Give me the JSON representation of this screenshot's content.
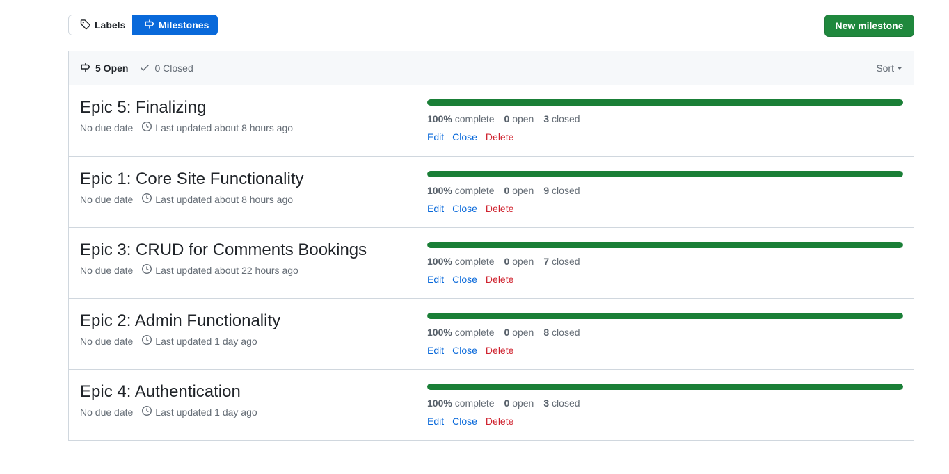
{
  "subnav": {
    "labels_label": "Labels",
    "milestones_label": "Milestones"
  },
  "new_milestone_label": "New milestone",
  "header": {
    "open_count": "5 Open",
    "closed_count": "0 Closed",
    "sort_label": "Sort"
  },
  "milestones": [
    {
      "title": "Epic 5: Finalizing",
      "due": "No due date",
      "updated": "Last updated about 8 hours ago",
      "percent": "100%",
      "percent_value": 100,
      "complete_label": "complete",
      "open": "0",
      "open_label": "open",
      "closed": "3",
      "closed_label": "closed",
      "edit": "Edit",
      "close": "Close",
      "delete": "Delete"
    },
    {
      "title": "Epic 1: Core Site Functionality",
      "due": "No due date",
      "updated": "Last updated about 8 hours ago",
      "percent": "100%",
      "percent_value": 100,
      "complete_label": "complete",
      "open": "0",
      "open_label": "open",
      "closed": "9",
      "closed_label": "closed",
      "edit": "Edit",
      "close": "Close",
      "delete": "Delete"
    },
    {
      "title": "Epic 3: CRUD for Comments Bookings",
      "due": "No due date",
      "updated": "Last updated about 22 hours ago",
      "percent": "100%",
      "percent_value": 100,
      "complete_label": "complete",
      "open": "0",
      "open_label": "open",
      "closed": "7",
      "closed_label": "closed",
      "edit": "Edit",
      "close": "Close",
      "delete": "Delete"
    },
    {
      "title": "Epic 2: Admin Functionality",
      "due": "No due date",
      "updated": "Last updated 1 day ago",
      "percent": "100%",
      "percent_value": 100,
      "complete_label": "complete",
      "open": "0",
      "open_label": "open",
      "closed": "8",
      "closed_label": "closed",
      "edit": "Edit",
      "close": "Close",
      "delete": "Delete"
    },
    {
      "title": "Epic 4: Authentication",
      "due": "No due date",
      "updated": "Last updated 1 day ago",
      "percent": "100%",
      "percent_value": 100,
      "complete_label": "complete",
      "open": "0",
      "open_label": "open",
      "closed": "3",
      "closed_label": "closed",
      "edit": "Edit",
      "close": "Close",
      "delete": "Delete"
    }
  ],
  "colors": {
    "primary": "#0969da",
    "success": "#1f883d",
    "progress": "#1a7f37",
    "danger": "#cf222e"
  },
  "icons": {
    "labels": "tag-icon",
    "milestones": "milestone-icon",
    "open": "milestone-icon",
    "closed": "check-icon",
    "updated": "clock-icon"
  }
}
